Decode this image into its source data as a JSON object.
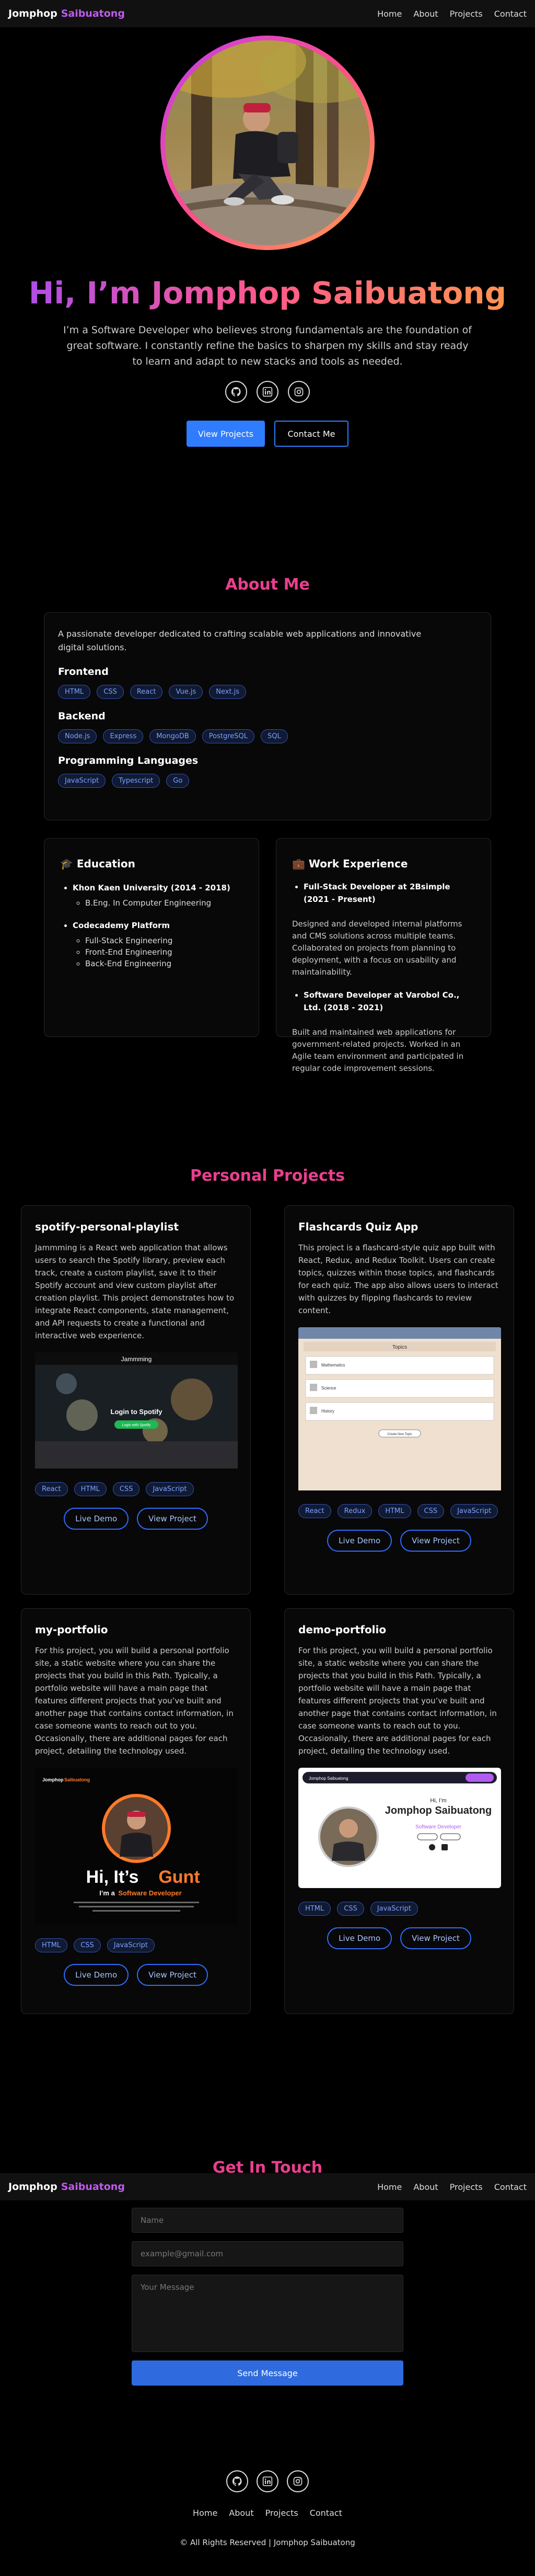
{
  "nav": {
    "logo_first": "Jomphop",
    "logo_second": "Saibuatong",
    "links": [
      "Home",
      "About",
      "Projects",
      "Contact"
    ]
  },
  "hero": {
    "heading": "Hi, I’m Jomphop Saibuatong",
    "intro": "I’m a Software Developer who believes strong fundamentals are the foundation of great software. I constantly refine the basics to sharpen my skills and stay ready to learn and adapt to new stacks and tools as needed.",
    "view_projects": "View Projects",
    "contact_me": "Contact Me"
  },
  "about": {
    "title": "About Me",
    "lead": "A passionate developer dedicated to crafting scalable web applications and innovative digital solutions.",
    "groups": [
      {
        "heading": "Frontend",
        "tags": [
          "HTML",
          "CSS",
          "React",
          "Vue.js",
          "Next.js"
        ]
      },
      {
        "heading": "Backend",
        "tags": [
          "Node.js",
          "Express",
          "MongoDB",
          "PostgreSQL",
          "SQL"
        ]
      },
      {
        "heading": "Programming Languages",
        "tags": [
          "JavaScript",
          "Typescript",
          "Go"
        ]
      }
    ]
  },
  "education": {
    "heading": "🎓 Education",
    "items": [
      {
        "title": "Khon Kaen University (2014 - 2018)",
        "sub": [
          "B.Eng. In Computer Engineering"
        ]
      },
      {
        "title": "Codecademy Platform",
        "sub": [
          "Full-Stack Engineering",
          "Front-End Engineering",
          "Back-End Engineering"
        ]
      }
    ]
  },
  "work": {
    "heading": "💼 Work Experience",
    "items": [
      {
        "title": "Full-Stack Developer at 2Bsimple (2021 - Present)",
        "desc": "Designed and developed internal platforms and CMS solutions across multiple teams. Collaborated on projects from planning to deployment, with a focus on usability and maintainability."
      },
      {
        "title": "Software Developer at Varobol Co., Ltd. (2018 - 2021)",
        "desc": "Built and maintained web applications for government-related projects. Worked in an Agile team environment and participated in regular code improvement sessions."
      }
    ]
  },
  "projects": {
    "title": "Personal Projects",
    "live_demo": "Live Demo",
    "view_project": "View Project",
    "items": [
      {
        "name": "spotify-personal-playlist",
        "desc": "Jammming is a React web application that allows users to search the Spotify library, preview each track, create a custom playlist, save it to their Spotify account and view custom playlist after creation playlist. This project demonstrates how to integrate React components, state management, and API requests to create a functional and interactive web experience.",
        "tags": [
          "React",
          "HTML",
          "CSS",
          "JavaScript"
        ],
        "shot_title": "Jammming",
        "shot_text": "Login to Spotify",
        "shot_btn": "Login with Spotify"
      },
      {
        "name": "Flashcards Quiz App",
        "desc": "This project is a flashcard-style quiz app built with React, Redux, and Redux Toolkit. Users can create topics, quizzes within those topics, and flashcards for each quiz. The app also allows users to interact with quizzes by flipping flashcards to review content.",
        "tags": [
          "React",
          "Redux",
          "HTML",
          "CSS",
          "JavaScript"
        ],
        "shot_title": "Topics",
        "shot_rows": [
          "Mathematics",
          "Science",
          "History"
        ],
        "shot_btn": "Create New Topic"
      },
      {
        "name": "my-portfolio",
        "desc": "For this project, you will build a personal portfolio site, a static website where you can share the projects that you build in this Path. Typically, a portfolio website will have a main page that features different projects that you’ve built and another page that contains contact information, in case someone wants to reach out to you. Occasionally, there are additional pages for each project, detailing the technology used.",
        "tags": [
          "HTML",
          "CSS",
          "JavaScript"
        ],
        "shot_logo_a": "Jomphop",
        "shot_logo_b": "Saibuatong",
        "shot_hi": "Hi, It’s",
        "shot_name": "Gunt",
        "shot_role_a": "I’m a",
        "shot_role_b": "Software Developer"
      },
      {
        "name": "demo-portfolio",
        "desc": "For this project, you will build a personal portfolio site, a static website where you can share the projects that you build in this Path. Typically, a portfolio website will have a main page that features different projects that you’ve built and another page that contains contact information, in case someone wants to reach out to you. Occasionally, there are additional pages for each project, detailing the technology used.",
        "tags": [
          "HTML",
          "CSS",
          "JavaScript"
        ],
        "shot_logo": "Jomphop Saibuatong",
        "shot_hi": "Hi, I’m",
        "shot_name": "Jomphop Saibuatong",
        "shot_role": "Software Developer"
      }
    ]
  },
  "contact": {
    "title": "Get In Touch",
    "name_placeholder": "Name",
    "email_placeholder": "example@gmail.com",
    "message_placeholder": "Your Message",
    "send": "Send Message"
  },
  "footer": {
    "links": [
      "Home",
      "About",
      "Projects",
      "Contact"
    ],
    "copyright": "© All Rights Reserved | Jomphop Saibuatong"
  },
  "icons": [
    "github-icon",
    "linkedin-icon",
    "instagram-icon"
  ],
  "colors": {
    "accent": "#e93f8e",
    "blue": "#2f7cff",
    "purple": "#c05bf0"
  }
}
